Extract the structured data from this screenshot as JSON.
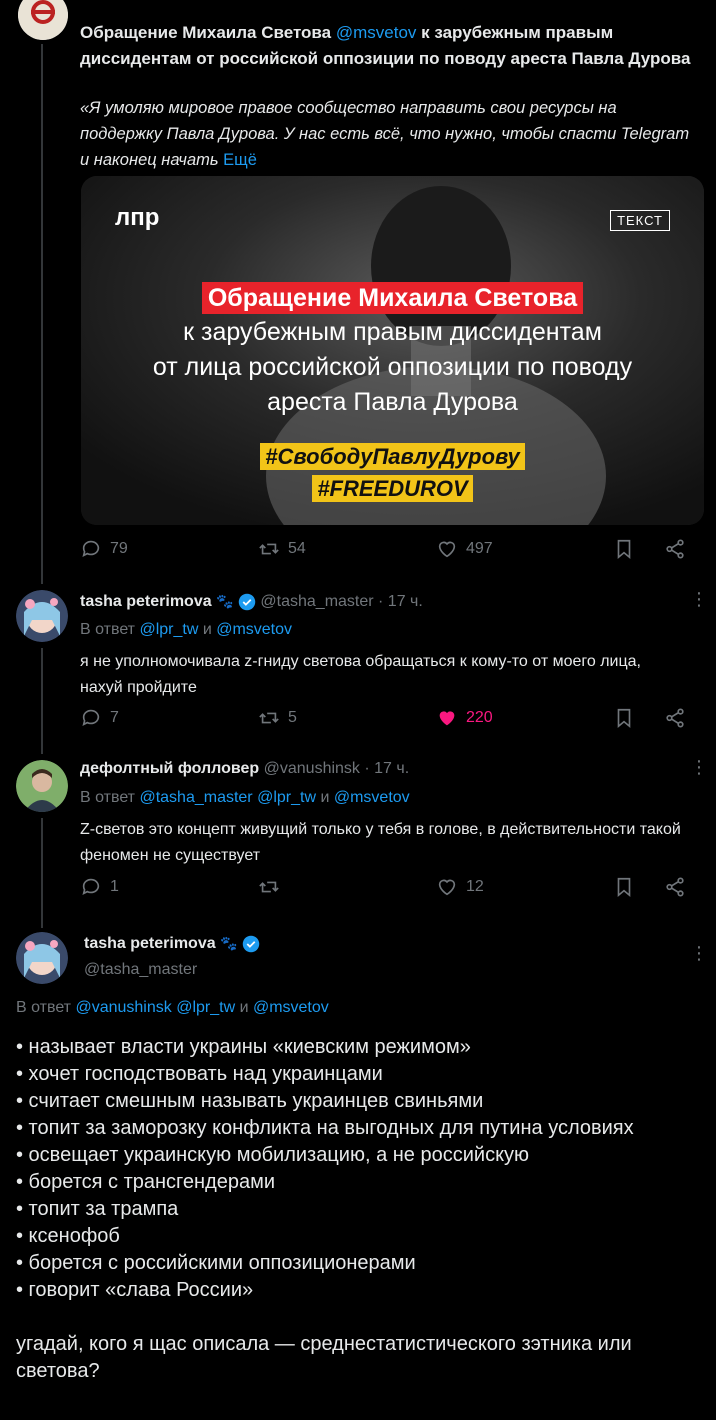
{
  "quoted_post": {
    "title_prefix": "Обращение Михаила Светова ",
    "title_mention": "@msvetov",
    "title_suffix": " к зарубежным правым диссидентам от российской оппозиции по поводу ареста Павла Дурова",
    "quote_text": "«Я умоляю мировое правое сообщество направить свои ресурсы на поддержку Павла Дурова. У нас есть всё, что нужно, чтобы спасти Telegram и наконец начать",
    "more_link": "Ещё",
    "image": {
      "logo": "лпр",
      "badge": "ТЕКСТ",
      "headline": "Обращение Михаила Светова",
      "line1": "к зарубежным правым диссидентам",
      "line2": "от лица российской оппозиции по поводу",
      "line3": "ареста Павла Дурова",
      "hashtag1": "#СвободуПавлуДурову",
      "hashtag2": "#FREEDUROV"
    },
    "replies": "79",
    "reposts": "54",
    "likes": "497"
  },
  "reply1": {
    "name": "tasha peterimova",
    "handle": "@tasha_master · 17 ч.",
    "reply_to_prefix": "В ответ ",
    "reply_to_1": "@lpr_tw",
    "reply_to_and": " и ",
    "reply_to_2": "@msvetov",
    "text": "я не уполномочивала z-гниду светова обращаться к кому-то от моего лица, нахуй пройдите",
    "replies": "7",
    "reposts": "5",
    "likes": "220"
  },
  "reply2": {
    "name": "дефолтный фолловер",
    "handle": "@vanushinsk · 17 ч.",
    "reply_to_prefix": "В ответ ",
    "reply_to_1": "@tasha_master",
    "reply_to_2": "@lpr_tw",
    "reply_to_and": " и ",
    "reply_to_3": "@msvetov",
    "text": "Z-светов это концепт живущий только у тебя в голове, в действительности такой феномен не существует",
    "replies": "1",
    "reposts": "",
    "likes": "12"
  },
  "main_post": {
    "name": "tasha peterimova",
    "handle": "@tasha_master",
    "reply_to_prefix": "В ответ ",
    "reply_to_1": "@vanushinsk",
    "reply_to_2": "@lpr_tw",
    "reply_to_and": " и ",
    "reply_to_3": "@msvetov",
    "lines": [
      "• называет власти украины «киевским режимом»",
      "• хочет господствовать над украинцами",
      "• считает смешным называть украинцев свиньями",
      "• топит за заморозку конфликта на выгодных для путина условиях",
      "• освещает украинскую мобилизацию, а не российскую",
      "• борется с трансгендерами",
      "• топит за трампа",
      "• ксенофоб",
      "• борется с российскими оппозиционерами",
      "• говорит «слава России»"
    ],
    "closing": "угадай, кого я щас описала — среднестатистического зэтника или светова?"
  },
  "colors": {
    "accent": "#1d9bf0",
    "like_active": "#f91880",
    "highlight_red": "#e8232b",
    "highlight_yellow": "#f2c418"
  }
}
